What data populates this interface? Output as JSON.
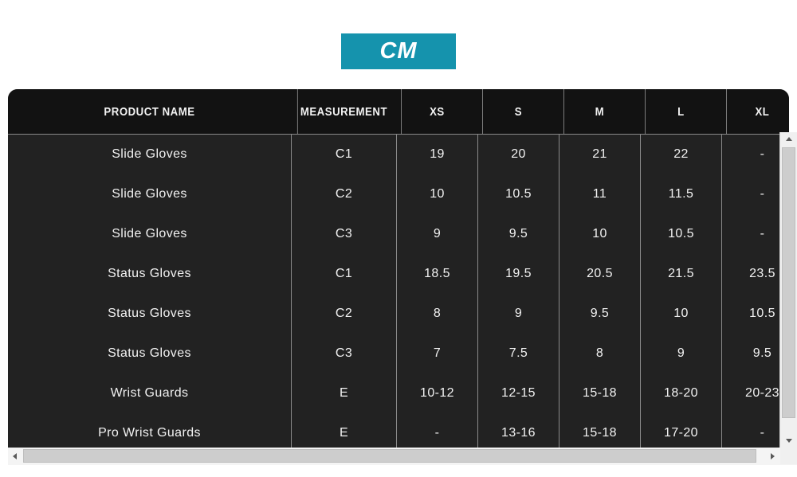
{
  "unit_tab": {
    "label": "CM",
    "accent_color": "#1593ad",
    "text_color": "#ffffff"
  },
  "table": {
    "columns": [
      {
        "key": "product",
        "label": "PRODUCT NAME"
      },
      {
        "key": "measurement",
        "label": "MEASUREMENT"
      },
      {
        "key": "xs",
        "label": "XS"
      },
      {
        "key": "s",
        "label": "S"
      },
      {
        "key": "m",
        "label": "M"
      },
      {
        "key": "l",
        "label": "L"
      },
      {
        "key": "xl",
        "label": "XL"
      }
    ],
    "rows": [
      {
        "product": "Slide Gloves",
        "measurement": "C1",
        "xs": "19",
        "s": "20",
        "m": "21",
        "l": "22",
        "xl": "-"
      },
      {
        "product": "Slide Gloves",
        "measurement": "C2",
        "xs": "10",
        "s": "10.5",
        "m": "11",
        "l": "11.5",
        "xl": "-"
      },
      {
        "product": "Slide Gloves",
        "measurement": "C3",
        "xs": "9",
        "s": "9.5",
        "m": "10",
        "l": "10.5",
        "xl": "-"
      },
      {
        "product": "Status Gloves",
        "measurement": "C1",
        "xs": "18.5",
        "s": "19.5",
        "m": "20.5",
        "l": "21.5",
        "xl": "23.5"
      },
      {
        "product": "Status Gloves",
        "measurement": "C2",
        "xs": "8",
        "s": "9",
        "m": "9.5",
        "l": "10",
        "xl": "10.5"
      },
      {
        "product": "Status Gloves",
        "measurement": "C3",
        "xs": "7",
        "s": "7.5",
        "m": "8",
        "l": "9",
        "xl": "9.5"
      },
      {
        "product": "Wrist Guards",
        "measurement": "E",
        "xs": "10-12",
        "s": "12-15",
        "m": "15-18",
        "l": "18-20",
        "xl": "20-23"
      },
      {
        "product": "Pro Wrist Guards",
        "measurement": "E",
        "xs": "-",
        "s": "13-16",
        "m": "15-18",
        "l": "17-20",
        "xl": "-"
      }
    ],
    "header_background": "#121212",
    "body_background": "#222222",
    "divider_color": "#8a8a8a",
    "text_color": "#f2f2f2"
  },
  "scrollbars": {
    "vertical": {
      "up_icon": "triangle-up-icon",
      "down_icon": "triangle-down-icon"
    },
    "horizontal": {
      "left_icon": "triangle-left-icon",
      "right_icon": "triangle-right-icon"
    }
  }
}
